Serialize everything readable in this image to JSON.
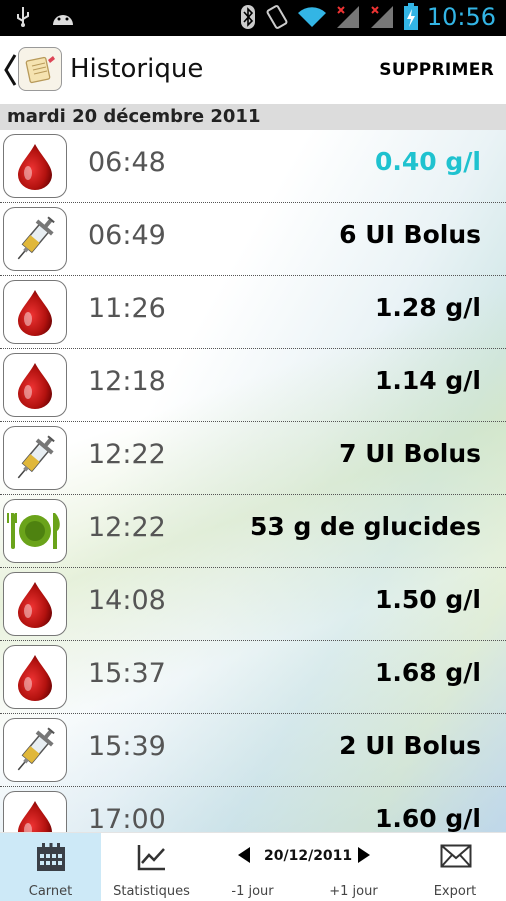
{
  "statusbar": {
    "time": "10:56"
  },
  "actionbar": {
    "title": "Historique",
    "delete_label": "SUPPRIMER"
  },
  "date_header": "mardi 20 décembre 2011",
  "entries": [
    {
      "type": "blood",
      "time": "06:48",
      "value": "0.40 g/l",
      "highlight": true
    },
    {
      "type": "syringe",
      "time": "06:49",
      "value": "6 UI Bolus",
      "highlight": false
    },
    {
      "type": "blood",
      "time": "11:26",
      "value": "1.28 g/l",
      "highlight": false
    },
    {
      "type": "blood",
      "time": "12:18",
      "value": "1.14 g/l",
      "highlight": false
    },
    {
      "type": "syringe",
      "time": "12:22",
      "value": "7 UI Bolus",
      "highlight": false
    },
    {
      "type": "meal",
      "time": "12:22",
      "value": "53 g de glucides",
      "highlight": false
    },
    {
      "type": "blood",
      "time": "14:08",
      "value": "1.50 g/l",
      "highlight": false
    },
    {
      "type": "blood",
      "time": "15:37",
      "value": "1.68 g/l",
      "highlight": false
    },
    {
      "type": "syringe",
      "time": "15:39",
      "value": "2 UI Bolus",
      "highlight": false
    },
    {
      "type": "blood",
      "time": "17:00",
      "value": "1.60 g/l",
      "highlight": false
    }
  ],
  "bottomnav": {
    "carnet": "Carnet",
    "statistiques": "Statistiques",
    "date": "20/12/2011",
    "prev_day": "-1 jour",
    "next_day": "+1 jour",
    "export": "Export"
  },
  "colors": {
    "accent": "#33b5e5",
    "highlight_value": "#1fc2cf",
    "blood": "#b3120f",
    "meal_green": "#6aa31a"
  }
}
